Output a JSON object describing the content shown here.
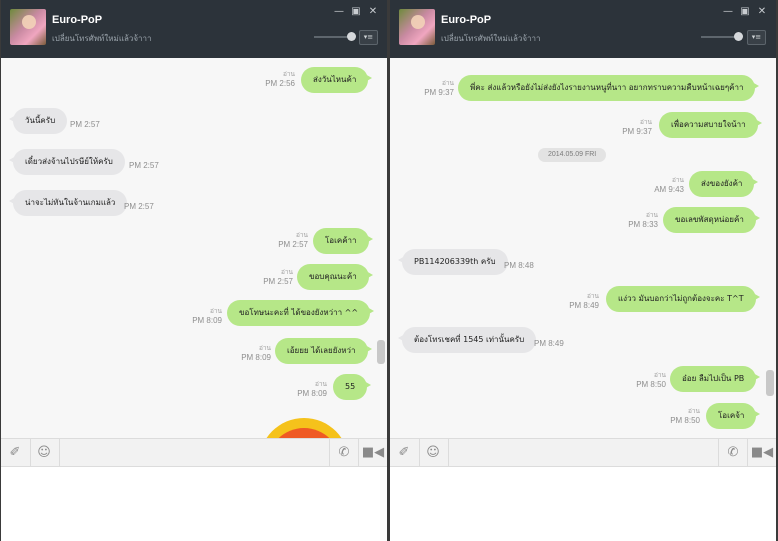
{
  "window_left": {
    "contact_name": "Euro-PoP",
    "status_message": "เปลี่ยนโทรศัพท์ใหม่แล้วจ้าาา",
    "messages": [
      {
        "text": "ส่งวันไหนค้า",
        "time": "PM 2:56",
        "read": "อ่าน"
      },
      {
        "text": "วันนี้ครับ",
        "time": "PM 2:57"
      },
      {
        "text": "เดี๋ยวส่งจ้านไปรษีย์ให้ครับ",
        "time": "PM 2:57"
      },
      {
        "text": "น่าจะไม่ทันในจ้านเกมแล้ว",
        "time": "PM 2:57"
      },
      {
        "text": "โอเคค้าา",
        "time": "PM 2:57",
        "read": "อ่าน"
      },
      {
        "text": "ขอบคุณนะค้า",
        "time": "PM 2:57",
        "read": "อ่าน"
      },
      {
        "text": "ขอโทษนะคะที่ ได้ของยังหว่าา ^^",
        "time": "PM 8:09",
        "read": "อ่าน"
      },
      {
        "text": "เอ้ยยย ได้เลยยังหว่า",
        "time": "PM 8:09",
        "read": "อ่าน"
      },
      {
        "text": "55",
        "time": "PM 8:09",
        "read": "อ่าน"
      }
    ],
    "icons": {
      "attach": "paperclip-icon",
      "emoji": "smiley-icon",
      "call": "phone-icon",
      "video": "video-camera-icon"
    }
  },
  "window_right": {
    "contact_name": "Euro-PoP",
    "status_message": "เปลี่ยนโทรศัพท์ใหม่แล้วจ้าาา",
    "date_separator": "2014.05.09 FRI",
    "messages": [
      {
        "text": "พี่คะ ส่งแล้วหรือยังไม่ส่งยังไงรายงานหนูที่นาา อยากทราบความคืบหน้าเฉยๆค้าา",
        "time": "PM 9:37",
        "read": "อ่าน"
      },
      {
        "text": "เพื่อความสบายใจน้าา",
        "time": "PM 9:37",
        "read": "อ่าน"
      },
      {
        "text": "ส่งของยังค้า",
        "time": "AM 9:43",
        "read": "อ่าน"
      },
      {
        "text": "ขอเลขพัสดุหน่อยค้า",
        "time": "PM 8:33",
        "read": "อ่าน"
      },
      {
        "text": "PB114206339th ครับ",
        "time": "PM 8:48"
      },
      {
        "text": "แง่วว มันบอกว่าไม่ถูกต้องจะคะ T^T",
        "time": "PM 8:49",
        "read": "อ่าน"
      },
      {
        "text": "ต้องโทรเชคที่ 1545 เท่านั้นครับ",
        "time": "PM 8:49"
      },
      {
        "text": "อ๋อย ลืมไปเป็น PB",
        "time": "PM 8:50",
        "read": "อ่าน"
      },
      {
        "text": "โอเคจ้า",
        "time": "PM 8:50",
        "read": "อ่าน"
      }
    ],
    "icons": {
      "attach": "paperclip-icon",
      "emoji": "smiley-icon",
      "call": "phone-icon",
      "video": "video-camera-icon"
    }
  },
  "colors": {
    "titlebar": "#2c333a",
    "bubble_out": "#b6e788",
    "bubble_in": "#e6e6e8",
    "chat_bg": "#f7f7f7"
  }
}
